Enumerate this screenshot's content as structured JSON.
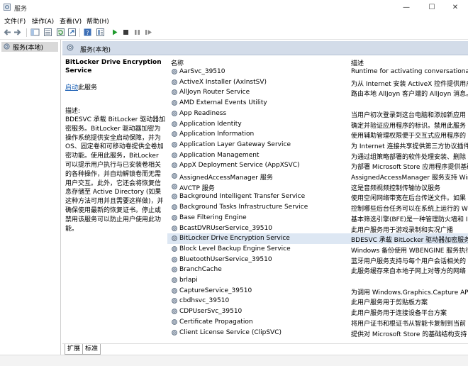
{
  "window": {
    "title": "服务",
    "buttons": {
      "minimize": "—",
      "maximize": "☐",
      "close": "✕"
    }
  },
  "menu": [
    "文件(F)",
    "操作(A)",
    "查看(V)",
    "帮助(H)"
  ],
  "tree": {
    "root_label": "服务(本地)"
  },
  "header": {
    "label": "服务(本地)"
  },
  "description": {
    "title": "BitLocker Drive Encryption Service",
    "start_link": "启动",
    "start_suffix": "此服务",
    "label": "描述:",
    "body": "BDESVC 承载 BitLocker 驱动器加密服务。BitLocker 驱动器加密为操作系统提供安全启动保障，并为 OS、固定卷和可移动卷提供全卷加密功能。使用此服务，BitLocker 可以提示用户执行与已安装卷相关的各种操作，并自动解锁卷而无需用户交互。此外，它还会将恢复信息存储至 Active Directory (如果这种方法可用并且需要这样做)，并确保使用最新的恢复证书。停止或禁用该服务可以防止用户使用此功能。"
  },
  "list": {
    "col_name": "名称",
    "col_desc": "描述",
    "selected_index": 16,
    "rows": [
      {
        "name": "AarSvc_39510",
        "desc": "Runtime for activating conversational ag"
      },
      {
        "name": "ActiveX Installer (AxInstSV)",
        "desc": "为从 Internet 安装 ActiveX 控件提供用户"
      },
      {
        "name": "AllJoyn Router Service",
        "desc": "路由本地 AllJoyn 客户端的 AllJoyn 消息。"
      },
      {
        "name": "AMD External Events Utility",
        "desc": ""
      },
      {
        "name": "App Readiness",
        "desc": "当用户初次登录到这台电脑和添加新应用"
      },
      {
        "name": "Application Identity",
        "desc": "确定并验证应用程序的标识。禁用此服务"
      },
      {
        "name": "Application Information",
        "desc": "使用辅助管理权限便于交互式应用程序的"
      },
      {
        "name": "Application Layer Gateway Service",
        "desc": "为 Internet 连接共享提供第三方协议插件"
      },
      {
        "name": "Application Management",
        "desc": "为通过组策略部署的软件处理安装、删除"
      },
      {
        "name": "AppX Deployment Service (AppXSVC)",
        "desc": "为部署 Microsoft Store 应用程序提供基础"
      },
      {
        "name": "AssignedAccessManager 服务",
        "desc": "AssignedAccessManager 服务支持 Windo"
      },
      {
        "name": "AVCTP 服务",
        "desc": "这是音频视频控制传输协议服务"
      },
      {
        "name": "Background Intelligent Transfer Service",
        "desc": "使用空闲网络带宽在后台传送文件。如果"
      },
      {
        "name": "Background Tasks Infrastructure Service",
        "desc": "控制哪些后台任务可以在系统上运行的 W"
      },
      {
        "name": "Base Filtering Engine",
        "desc": "基本筛选引擎(BFE)是一种管理防火墙和 In"
      },
      {
        "name": "BcastDVRUserService_39510",
        "desc": "此用户服务用于游戏录制和实况广播"
      },
      {
        "name": "BitLocker Drive Encryption Service",
        "desc": "BDESVC 承载 BitLocker 驱动器加密服务。"
      },
      {
        "name": "Block Level Backup Engine Service",
        "desc": "Windows 备份使用 WBENGINE 服务执行备"
      },
      {
        "name": "BluetoothUserService_39510",
        "desc": "蓝牙用户服务支持与每个用户会话相关的"
      },
      {
        "name": "BranchCache",
        "desc": "此服务缓存来自本地子网上对等方的网络"
      },
      {
        "name": "brlapi",
        "desc": ""
      },
      {
        "name": "CaptureService_39510",
        "desc": "为调用 Windows.Graphics.Capture API 的"
      },
      {
        "name": "cbdhsvc_39510",
        "desc": "此用户服务用于剪贴板方案"
      },
      {
        "name": "CDPUserSvc_39510",
        "desc": "此用户服务用于连接设备平台方案"
      },
      {
        "name": "Certificate Propagation",
        "desc": "将用户证书和根证书从智能卡复制到当前"
      },
      {
        "name": "Client License Service (ClipSVC)",
        "desc": "提供对 Microsoft Store 的基础结构支持"
      }
    ]
  },
  "tabs": [
    "扩展",
    "标准"
  ],
  "colors": {
    "header_bg": "#d3dce9",
    "selected_row": "#dde7f3",
    "link": "#1a5fb4"
  }
}
